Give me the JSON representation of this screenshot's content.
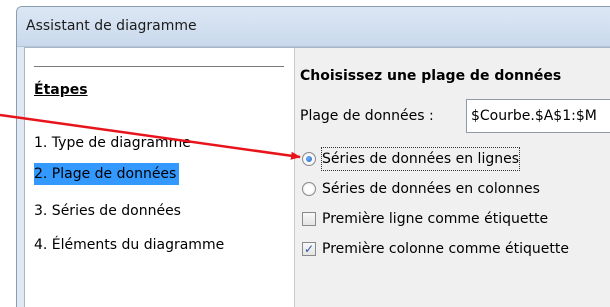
{
  "window": {
    "title": "Assistant de diagramme"
  },
  "steps": {
    "heading": "Étapes",
    "items": [
      {
        "label": "1. Type de diagramme"
      },
      {
        "label": "2. Plage de données"
      },
      {
        "label": "3. Séries de données"
      },
      {
        "label": "4. Éléments du diagramme"
      }
    ],
    "selected_index": 1
  },
  "range": {
    "section_title": "Choisissez une plage de données",
    "field_label": "Plage de données :",
    "field_value": "$Courbe.$A$1:$M"
  },
  "options": {
    "series_rows": {
      "label": "Séries de données en lignes",
      "checked": true
    },
    "series_columns": {
      "label": "Séries de données en colonnes",
      "checked": false
    },
    "first_row_label": {
      "label": "Première ligne comme étiquette",
      "checked": false
    },
    "first_column_label": {
      "label": "Première colonne comme étiquette",
      "checked": true
    }
  },
  "annotation": {
    "color": "#e8141b"
  }
}
